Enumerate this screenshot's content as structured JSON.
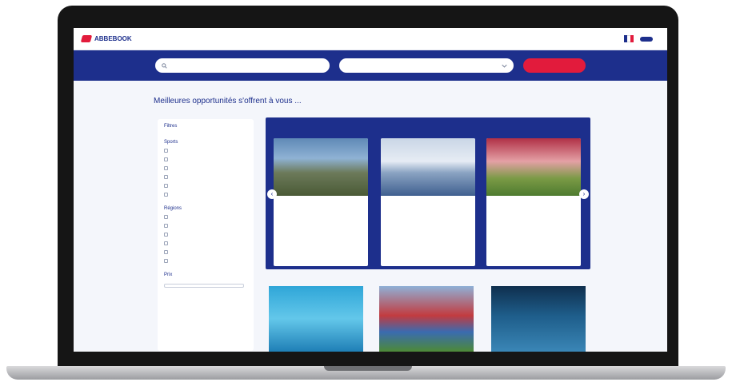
{
  "header": {
    "logo_text": "ABBEBOOK",
    "nav": [
      "",
      "",
      "",
      ""
    ],
    "primary_button": "",
    "secondary_link": "",
    "flag_colors": [
      "#1d2f8c",
      "#ffffff",
      "#e21b3c"
    ]
  },
  "search": {
    "first_placeholder": "",
    "second_placeholder": "",
    "button_label": ""
  },
  "page": {
    "title": "Meilleures opportunités s'offrent à vous ...",
    "results": ""
  },
  "filters": {
    "title": "Filtres",
    "groups": [
      {
        "label": "Sports",
        "items": [
          "",
          "",
          "",
          "",
          "",
          ""
        ],
        "more": ""
      },
      {
        "label": "Régions",
        "items": [
          "",
          "",
          "",
          "",
          "",
          ""
        ],
        "more": ""
      },
      {
        "label": "Prix",
        "range_value": ""
      }
    ]
  },
  "featured": {
    "title": "",
    "cards": [
      {
        "category": "",
        "title": "",
        "date": "",
        "footer": "",
        "price": ""
      },
      {
        "category": "",
        "title": "",
        "date": "",
        "footer": "",
        "price": ""
      },
      {
        "category": "",
        "title": "",
        "date": "",
        "footer": "",
        "price": ""
      }
    ]
  },
  "icons": {
    "search": "search-icon",
    "chevron": "chevron-down-icon",
    "prev": "arrow-left-icon",
    "next": "arrow-right-icon"
  },
  "colors": {
    "primary": "#1d2f8c",
    "accent": "#e21b3c",
    "background": "#f4f6fb"
  }
}
